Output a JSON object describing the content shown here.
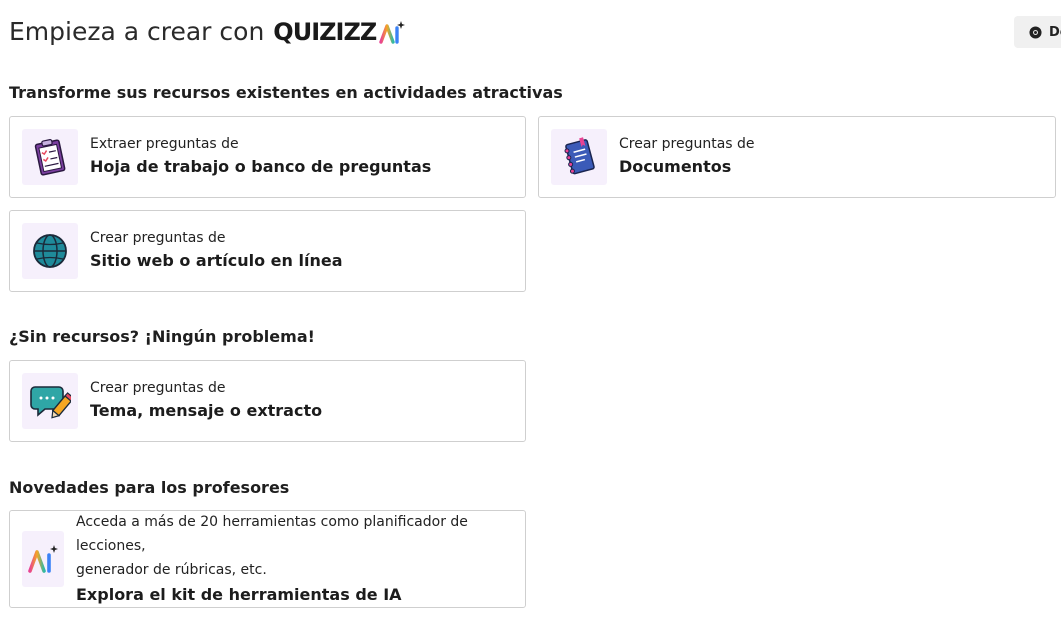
{
  "header": {
    "title_prefix": "Empieza a crear con",
    "brand": "QUIZIZZ",
    "brand_ai": "AI",
    "top_button_label": "De"
  },
  "sections": {
    "resources_title": "Transforme sus recursos existentes en actividades atractivas",
    "no_resources_title": "¿Sin recursos? ¡Ningún problema!",
    "news_title": "Novedades para los profesores"
  },
  "cards": {
    "worksheet": {
      "sub": "Extraer preguntas de",
      "main": "Hoja de trabajo o banco de preguntas",
      "icon": "clipboard-icon"
    },
    "documents": {
      "sub": "Crear preguntas de",
      "main": "Documentos",
      "icon": "notebook-icon"
    },
    "website": {
      "sub": "Crear preguntas de",
      "main": "Sitio web o artículo en línea",
      "icon": "globe-icon"
    },
    "topic": {
      "sub": "Crear preguntas de",
      "main": "Tema, mensaje o extracto",
      "icon": "chat-pencil-icon"
    },
    "ai_kit": {
      "sub_line1": "Acceda a más de 20 herramientas como planificador de lecciones,",
      "sub_line2": "generador de rúbricas, etc.",
      "main": "Explora el kit de herramientas de IA",
      "icon": "ai-sparkle-icon"
    }
  },
  "colors": {
    "tile_background": "#f6f0fc",
    "card_border": "#cfcfcf",
    "brand_ai_gradient": [
      "#e84393",
      "#f5a623",
      "#2fb9a5",
      "#3b82f6"
    ]
  }
}
